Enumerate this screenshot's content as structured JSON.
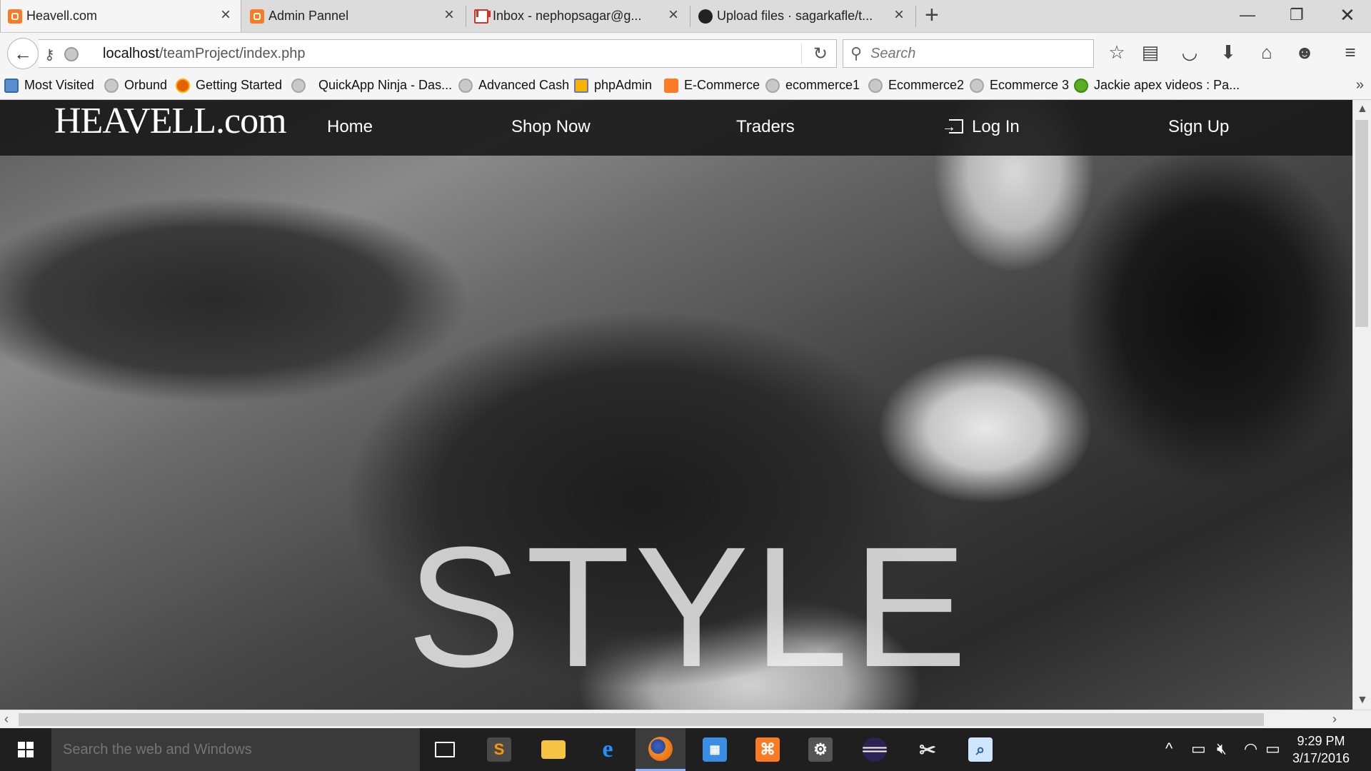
{
  "browser": {
    "tabs": [
      {
        "label": "Heavell.com",
        "icon": "xampp-icon",
        "active": true
      },
      {
        "label": "Admin Pannel",
        "icon": "xampp-icon",
        "active": false
      },
      {
        "label": "Inbox - nephopsagar@g...",
        "icon": "gmail-icon",
        "active": false
      },
      {
        "label": "Upload files · sagarkafle/t...",
        "icon": "github-icon",
        "active": false
      }
    ],
    "url_host": "localhost",
    "url_path": "/teamProject/index.php",
    "search_placeholder": "Search",
    "bookmarks": [
      {
        "label": "Most Visited",
        "icon": "most-visited-icon"
      },
      {
        "label": "Orbund",
        "icon": "globe-icon"
      },
      {
        "label": "Getting Started",
        "icon": "firefox-icon"
      },
      {
        "label": "QuickApp Ninja - Das...",
        "icon": "globe-icon"
      },
      {
        "label": "Advanced Cash",
        "icon": "globe-icon"
      },
      {
        "label": "phpAdmin",
        "icon": "phpmyadmin-icon"
      },
      {
        "label": "E-Commerce",
        "icon": "xampp-icon"
      },
      {
        "label": "ecommerce1",
        "icon": "globe-icon"
      },
      {
        "label": "Ecommerce2",
        "icon": "globe-icon"
      },
      {
        "label": "Ecommerce 3",
        "icon": "globe-icon"
      },
      {
        "label": "Jackie apex videos : Pa...",
        "icon": "play-icon"
      }
    ]
  },
  "site": {
    "logo": "HEAVELL.com",
    "nav": {
      "home": "Home",
      "shop": "Shop Now",
      "traders": "Traders",
      "login": "Log In",
      "signup": "Sign Up"
    },
    "hero_text": "STYLE"
  },
  "taskbar": {
    "search_placeholder": "Search the web and Windows",
    "time": "9:29 PM",
    "date": "3/17/2016"
  },
  "colors": {
    "xampp": "#fb7a24",
    "site_nav_bg": "#181818",
    "taskbar_bg": "#1f1f1f"
  }
}
